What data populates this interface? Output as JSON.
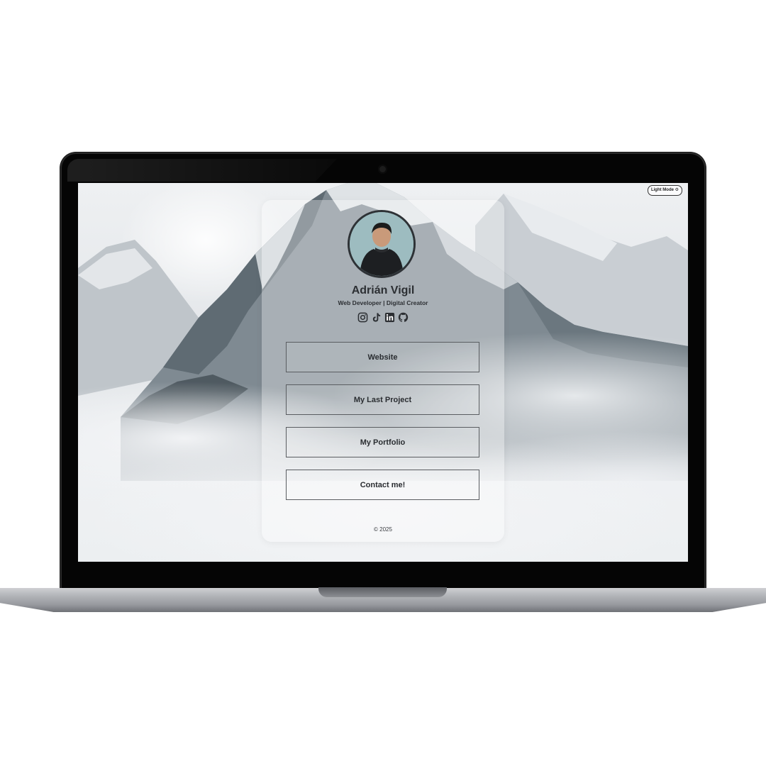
{
  "toggle": {
    "label": "Light Mode ⚙"
  },
  "profile": {
    "name": "Adrián Vigil",
    "subtitle": "Web Developer | Digital Creator"
  },
  "socials": [
    {
      "icon": "instagram-icon"
    },
    {
      "icon": "tiktok-icon"
    },
    {
      "icon": "linkedin-icon"
    },
    {
      "icon": "github-icon"
    }
  ],
  "links": [
    {
      "label": "Website"
    },
    {
      "label": "My Last Project"
    },
    {
      "label": "My Portfolio"
    },
    {
      "label": "Contact me!"
    }
  ],
  "footer": {
    "text": "© 2025"
  },
  "colors": {
    "text": "#2c2f33",
    "border": "#5a5d61",
    "bezel": "#050505"
  }
}
